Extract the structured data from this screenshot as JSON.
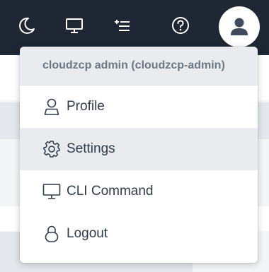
{
  "topbar": {
    "icons": [
      "moon-icon",
      "monitor-icon",
      "add-list-icon",
      "help-icon",
      "user-avatar-icon"
    ]
  },
  "dropdown": {
    "header": "cloudzcp admin (cloudzcp-admin)",
    "items": [
      {
        "label": "Profile",
        "icon": "user-icon"
      },
      {
        "label": "Settings",
        "icon": "gear-icon",
        "active": true
      },
      {
        "label": "CLI Command",
        "icon": "monitor-icon"
      },
      {
        "label": "Logout",
        "icon": "lock-icon"
      }
    ]
  },
  "colors": {
    "topbar": "#1e2733",
    "menu_text": "#2f3b4a",
    "header_text": "#6d7883",
    "active_bg": "#e9ebee"
  }
}
